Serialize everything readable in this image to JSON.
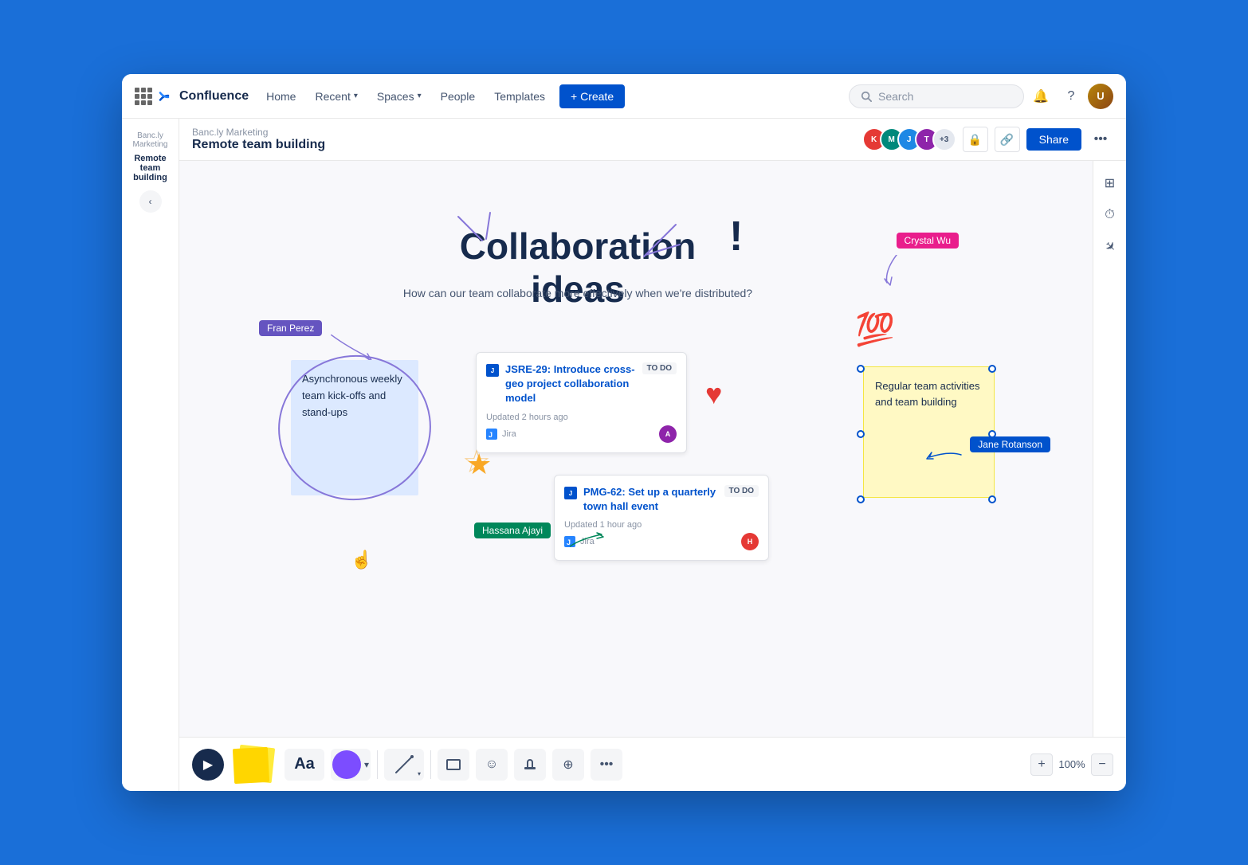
{
  "app": {
    "name": "Confluence",
    "logo_letter": "✕"
  },
  "nav": {
    "home": "Home",
    "recent": "Recent",
    "spaces": "Spaces",
    "people": "People",
    "templates": "Templates",
    "create": "+ Create",
    "search_placeholder": "Search"
  },
  "breadcrumb": "Banc.ly Marketing",
  "page_title": "Remote team building",
  "header": {
    "avatar_count": "+3",
    "share_btn": "Share"
  },
  "canvas": {
    "title": "Collaboration ideas",
    "subtitle": "How can our team collaborate more effectively when we're distributed?",
    "sticky_blue": "Asynchronous weekly team kick-offs and stand-ups",
    "sticky_yellow": "Regular team activities and team building",
    "label_fran": "Fran Perez",
    "label_crystal": "Crystal Wu",
    "label_jane": "Jane Rotanson",
    "label_hassana": "Hassana Ajayi",
    "jira_card1_title": "JSRE-29: Introduce cross-geo project collaboration model",
    "jira_card1_badge": "TO DO",
    "jira_card1_meta": "Updated 2 hours ago",
    "jira_card1_source": "Jira",
    "jira_card2_title": "PMG-62: Set up a quarterly town hall event",
    "jira_card2_badge": "TO DO",
    "jira_card2_meta": "Updated 1 hour ago",
    "jira_card2_source": "Jira"
  },
  "toolbar": {
    "text_btn": "Aa",
    "zoom_level": "100%",
    "zoom_plus": "+",
    "zoom_minus": "−",
    "more_options": "..."
  },
  "right_sidebar": {
    "table_icon": "⊞",
    "timer_icon": "⏱",
    "pointer_icon": "✈"
  }
}
